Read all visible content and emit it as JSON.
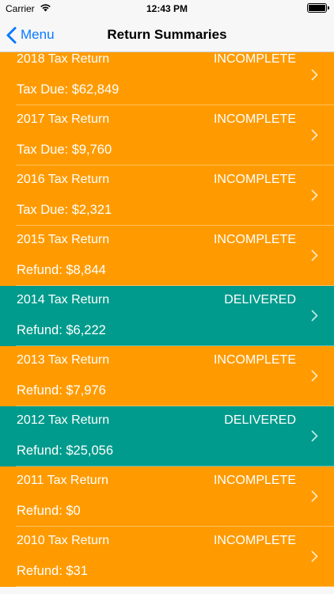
{
  "status_bar": {
    "carrier": "Carrier",
    "time": "12:43 PM"
  },
  "nav": {
    "back_label": "Menu",
    "title": "Return Summaries"
  },
  "colors": {
    "incomplete": "#ff9b00",
    "delivered": "#009b8c",
    "accent": "#0a7aff"
  },
  "returns": [
    {
      "title": "2018 Tax Return",
      "status": "INCOMPLETE",
      "amount": "Tax Due: $62,849",
      "kind": "incomplete"
    },
    {
      "title": "2017 Tax Return",
      "status": "INCOMPLETE",
      "amount": "Tax Due: $9,760",
      "kind": "incomplete"
    },
    {
      "title": "2016 Tax Return",
      "status": "INCOMPLETE",
      "amount": "Tax Due: $2,321",
      "kind": "incomplete"
    },
    {
      "title": "2015 Tax Return",
      "status": "INCOMPLETE",
      "amount": "Refund: $8,844",
      "kind": "incomplete"
    },
    {
      "title": "2014 Tax Return",
      "status": "DELIVERED",
      "amount": "Refund: $6,222",
      "kind": "delivered"
    },
    {
      "title": "2013 Tax Return",
      "status": "INCOMPLETE",
      "amount": "Refund: $7,976",
      "kind": "incomplete"
    },
    {
      "title": "2012 Tax Return",
      "status": "DELIVERED",
      "amount": "Refund: $25,056",
      "kind": "delivered"
    },
    {
      "title": "2011 Tax Return",
      "status": "INCOMPLETE",
      "amount": "Refund: $0",
      "kind": "incomplete"
    },
    {
      "title": "2010 Tax Return",
      "status": "INCOMPLETE",
      "amount": "Refund: $31",
      "kind": "incomplete"
    }
  ]
}
